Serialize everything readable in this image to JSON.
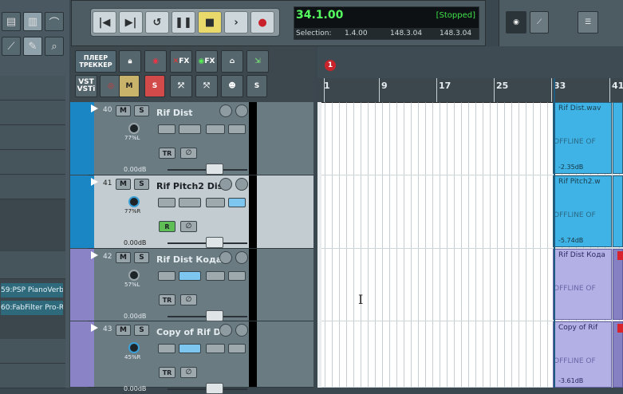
{
  "transport": {
    "buttons": [
      {
        "name": "go-to-start-button",
        "glyph": "|◀"
      },
      {
        "name": "go-to-end-button",
        "glyph": "▶|"
      },
      {
        "name": "loop-button",
        "glyph": "↺"
      },
      {
        "name": "pause-button",
        "glyph": "❚❚"
      },
      {
        "name": "stop-button",
        "glyph": "■"
      },
      {
        "name": "play-button",
        "glyph": "›"
      },
      {
        "name": "record-button",
        "glyph": "●"
      }
    ],
    "position": "34.1.00",
    "state": "[Stopped]",
    "selection_label": "Selection:",
    "selection_start": "1.4.00",
    "selection_end": "148.3.04",
    "selection_length": "148.3.04"
  },
  "tcp_toolbar": {
    "player_label_1": "ПЛЕЕР",
    "player_label_2": "ТРЕККЕР",
    "vst_label_1": "VST",
    "vst_label_2": "VSTi",
    "fx_label": "FX",
    "m_label": "M",
    "s_label": "S"
  },
  "marker": "1",
  "ruler": [
    {
      "label": "1"
    },
    {
      "label": "9"
    },
    {
      "label": "17"
    },
    {
      "label": "25"
    },
    {
      "label": "33"
    },
    {
      "label": "41"
    }
  ],
  "fx_chain": [
    {
      "label": "59:PSP PianoVerb"
    },
    {
      "label": "60:FabFilter Pro-R"
    }
  ],
  "tracks": [
    {
      "number": "40",
      "name": "Rif Dist",
      "pan": "77%L",
      "volume": "0.00dB",
      "record_label": "TR",
      "phase_label": "∅",
      "mute": "M",
      "solo": "S",
      "item_title": "Rif Dist.wav",
      "item_offline": "OFFLINE    OF",
      "item_db": "-2.35dB",
      "strip_color": "#1b86c4"
    },
    {
      "number": "41",
      "name": "Rif Pitch2 Dist",
      "pan": "77%R",
      "volume": "0.00dB",
      "record_label": "R",
      "phase_label": "∅",
      "mute": "M",
      "solo": "S",
      "item_title": "Rif Pitch2.w",
      "item_offline": "OFFLINE    OF",
      "item_db": "-5.74dB",
      "strip_color": "#1b86c4"
    },
    {
      "number": "42",
      "name": "Rif Dist Кода",
      "pan": "57%L",
      "volume": "0.00dB",
      "record_label": "TR",
      "phase_label": "∅",
      "mute": "M",
      "solo": "S",
      "item_title": "Rif Dist Кода",
      "item_offline": "OFFLINE    OF",
      "item_db": "",
      "strip_color": "#8a84c6"
    },
    {
      "number": "43",
      "name": "Copy of    Rif D",
      "pan": "45%R",
      "volume": "0.00dB",
      "record_label": "TR",
      "phase_label": "∅",
      "mute": "M",
      "solo": "S",
      "item_title": "Copy of    Rif",
      "item_offline": "OFFLINE    OF",
      "item_db": "-3.61dB",
      "strip_color": "#8a84c6"
    }
  ],
  "colors": {
    "accent": "#1b86c4",
    "purple": "#8a84c6",
    "display_green": "#55ff60"
  }
}
